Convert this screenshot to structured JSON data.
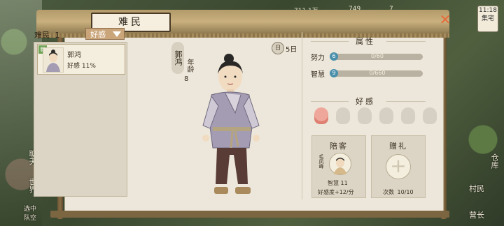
{
  "background": {
    "left_labels": [
      "聊天",
      "世界",
      "选中 队空"
    ],
    "right_labels": [
      "仓库",
      "村民",
      "营长"
    ],
    "resources": [
      "711.1万",
      "749",
      "7"
    ],
    "clock_labels": [
      "11:18",
      "集宅"
    ]
  },
  "window": {
    "title": "难民",
    "close": "✕"
  },
  "side_tabs": [
    {
      "label": "村民",
      "active": false
    },
    {
      "label": "难民",
      "active": true,
      "badge": "新"
    }
  ],
  "list": {
    "header": "难民",
    "count": "1",
    "filter": "好感",
    "items": [
      {
        "badge": "新",
        "name": "郭鸿",
        "favor": "好感 11%"
      }
    ]
  },
  "character": {
    "name": "郭鸿",
    "age_label": "年龄",
    "age": "8",
    "days": "5日",
    "day_icon": "日"
  },
  "attributes": {
    "title": "属性",
    "stats": [
      {
        "label": "努力",
        "value": "6",
        "text": "0/60",
        "fraction": 0.0
      },
      {
        "label": "智慧",
        "value": "9",
        "text": "0/660",
        "fraction": 0.0
      }
    ]
  },
  "favor": {
    "title": "好感",
    "levels_filled": 1,
    "levels_total": 6
  },
  "companion": {
    "title": "陪客",
    "guest_name": "毛凤峰",
    "wisdom": "智慧 11",
    "rate": "好感度+12/分"
  },
  "gift": {
    "title": "赠礼",
    "plus": "+",
    "count_label": "次数",
    "count": "10/10"
  },
  "colors": {
    "accent_blue": "#6aa2b8",
    "filter_tan": "#caa57a",
    "favor_pink": "#f0a79b"
  }
}
